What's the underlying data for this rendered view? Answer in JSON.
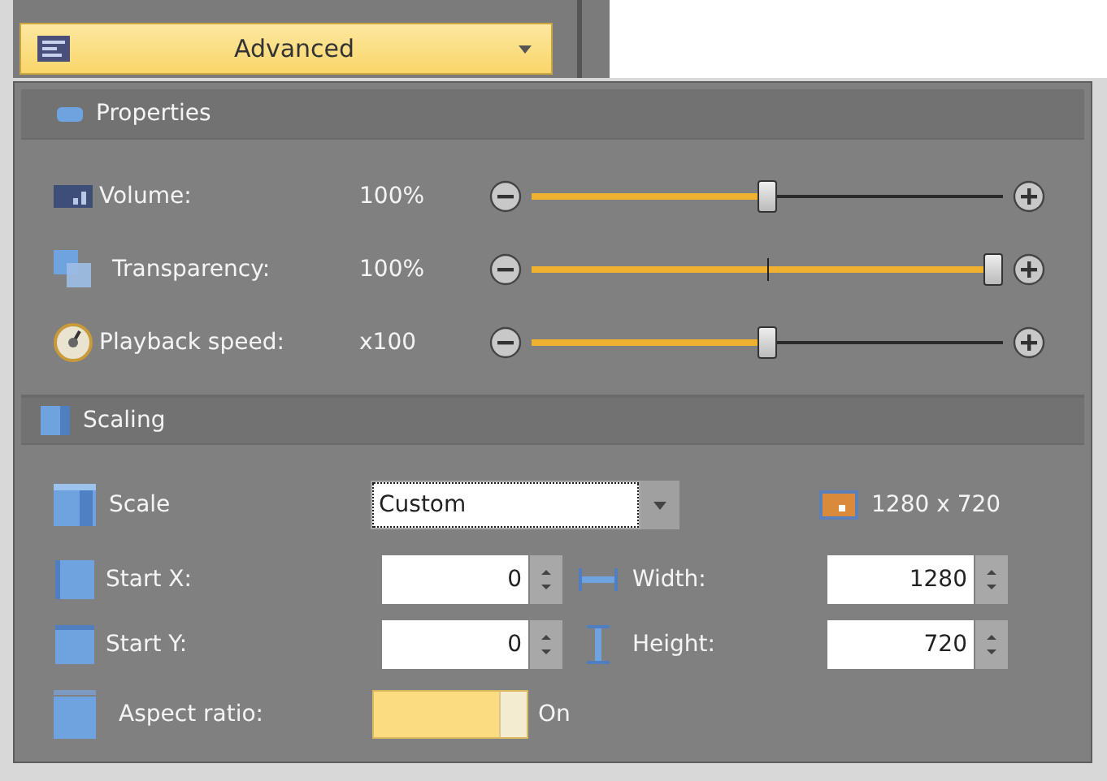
{
  "dropdown": {
    "label": "Advanced"
  },
  "properties": {
    "title": "Properties",
    "sliders": [
      {
        "label": "Volume:",
        "reading": "100%",
        "level": 0.5
      },
      {
        "label": "Transparency:",
        "reading": "100%",
        "level": 1.0,
        "center_mark": true
      },
      {
        "label": "Playback speed:",
        "reading": "x100",
        "level": 0.5
      }
    ]
  },
  "scaling": {
    "title": "Scaling",
    "scale": {
      "label": "Scale",
      "value": "Custom"
    },
    "resolution": "1280 x 720",
    "fields": [
      {
        "label": "Start X:",
        "value": "0"
      },
      {
        "label": "Width:",
        "value": "1280"
      },
      {
        "label": "Start Y:",
        "value": "0"
      },
      {
        "label": "Height:",
        "value": "720"
      }
    ],
    "aspect_ratio": {
      "label": "Aspect ratio:",
      "on": true,
      "state_label": "On"
    }
  }
}
